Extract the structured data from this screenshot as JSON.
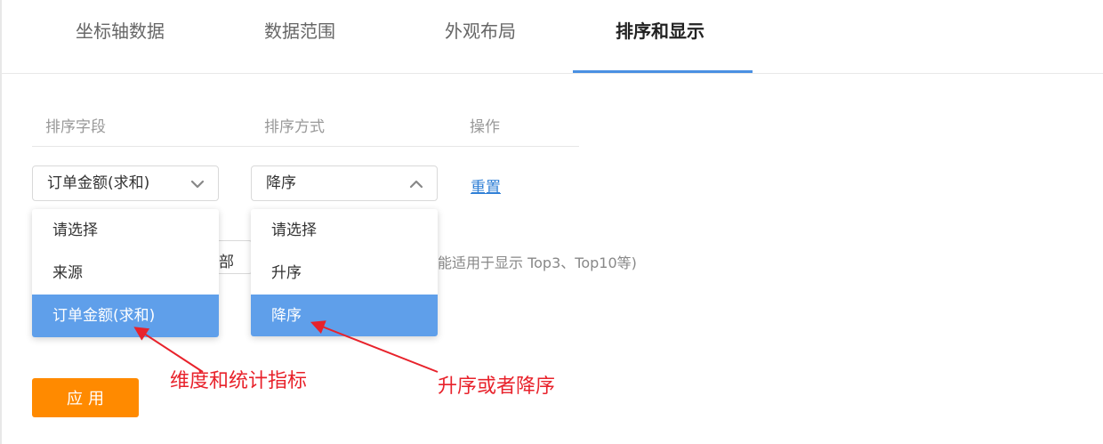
{
  "tabs": [
    {
      "label": "坐标轴数据",
      "active": false
    },
    {
      "label": "数据范围",
      "active": false
    },
    {
      "label": "外观布局",
      "active": false
    },
    {
      "label": "排序和显示",
      "active": true
    }
  ],
  "table": {
    "headers": [
      "排序字段",
      "排序方式",
      "操作"
    ]
  },
  "row": {
    "sort_field": "订单金额(求和)",
    "sort_order": "降序",
    "reset_label": "重置"
  },
  "sort_field_menu": {
    "options": [
      "请选择",
      "来源",
      "订单金额(求和)"
    ],
    "selected_index": 2
  },
  "sort_order_menu": {
    "options": [
      "请选择",
      "升序",
      "降序"
    ],
    "selected_index": 2
  },
  "background": {
    "partial_input_text": "部",
    "partial_hint": "能适用于显示 Top3、Top10等)"
  },
  "apply_label": "应用",
  "annotations": {
    "field_note": "维度和统计指标",
    "order_note": "升序或者降序"
  },
  "colors": {
    "accent": "#4a90e2",
    "selected_bg": "#5f9fea",
    "apply_bg": "#ff8a00",
    "annotation": "#e8222b",
    "link": "#2f7fd6"
  },
  "icons": {
    "field_select": "chevron-down-icon",
    "order_select": "chevron-up-icon"
  }
}
